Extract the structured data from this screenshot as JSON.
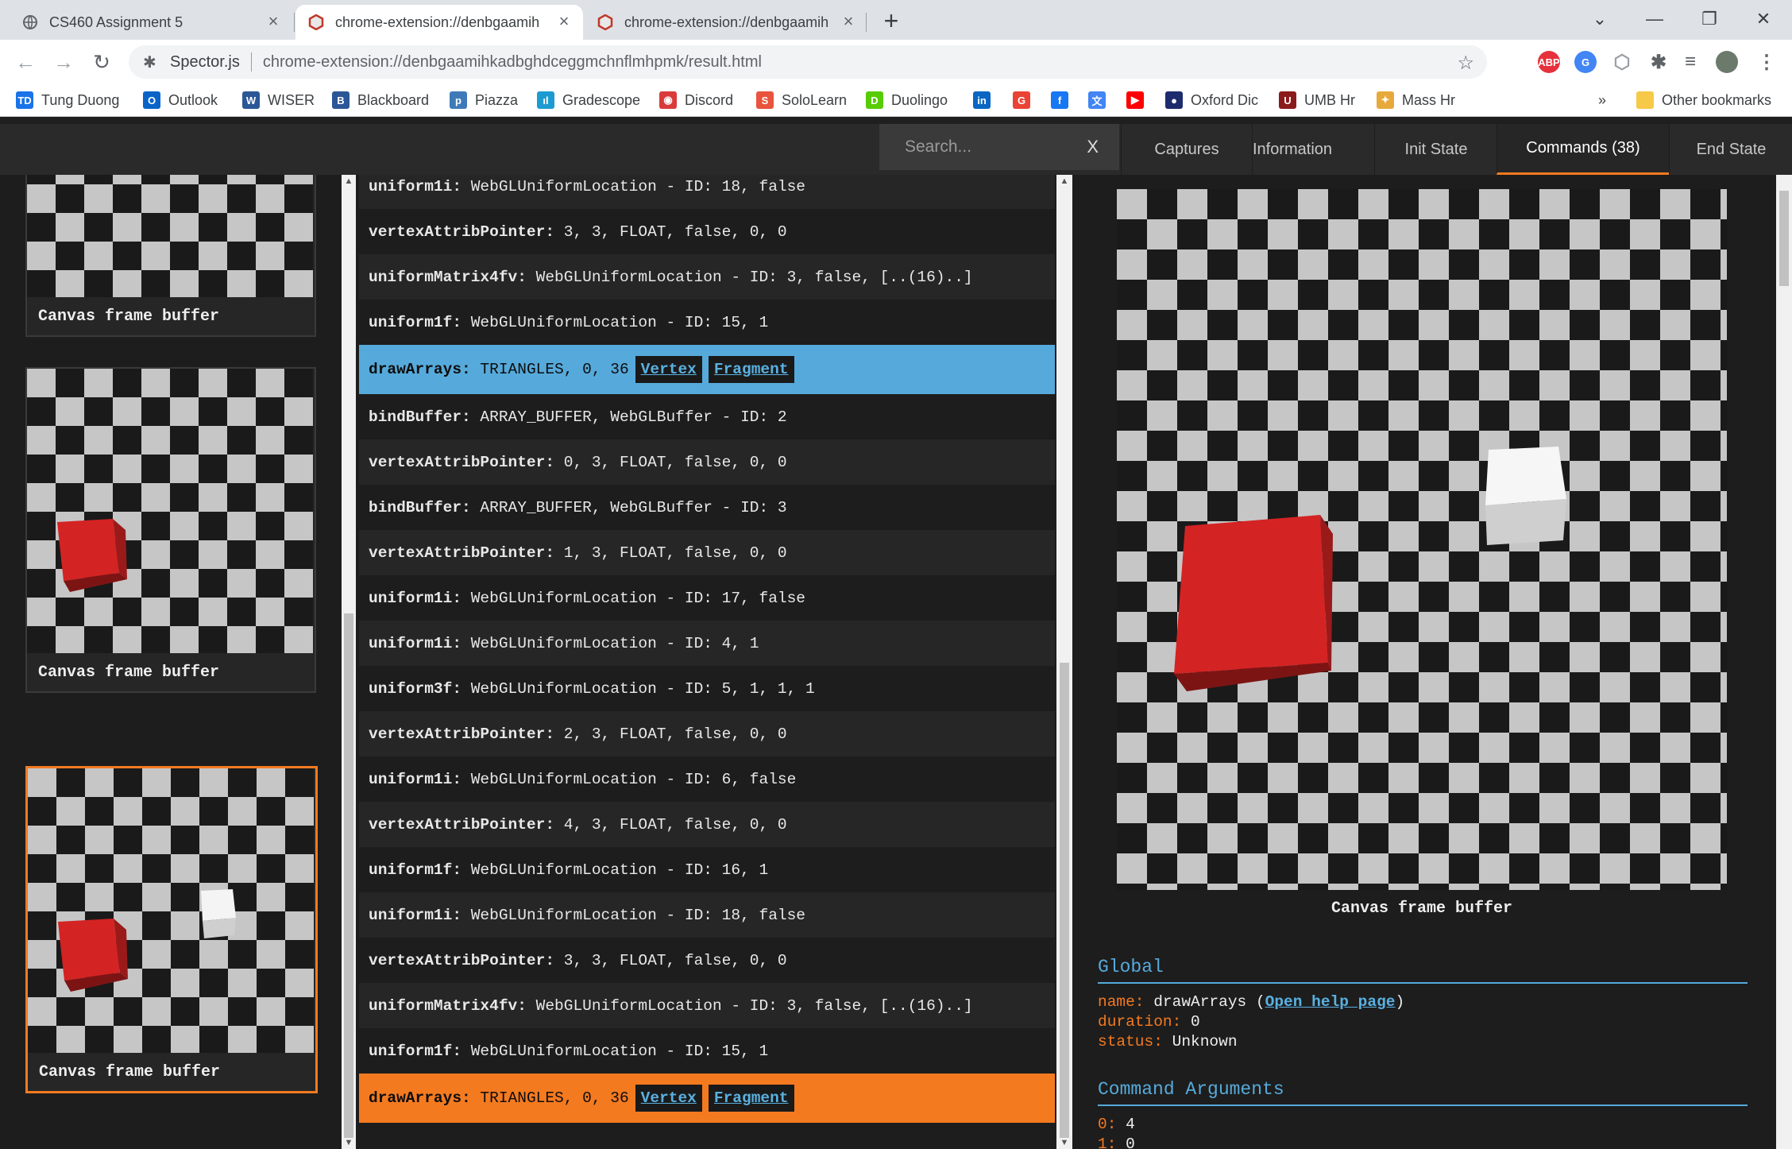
{
  "browser": {
    "tabs": [
      {
        "title": "CS460 Assignment 5",
        "active": false
      },
      {
        "title": "chrome-extension://denbgaamih",
        "active": true
      },
      {
        "title": "chrome-extension://denbgaamih",
        "active": false
      }
    ],
    "new_tab": "+",
    "window_controls": {
      "tabsearch": "⌄",
      "minimize": "—",
      "restore": "❐",
      "close": "✕"
    },
    "address": {
      "site": "Spector.js",
      "url": "chrome-extension://denbgaamihkadbghdceggmchnflmhpmk/result.html"
    },
    "extensions": [
      {
        "name": "adblock-plus-icon",
        "label": "ABP",
        "color": "#e6313c"
      },
      {
        "name": "google-translate-icon",
        "label": "G",
        "color": "#4285f4"
      },
      {
        "name": "spector-icon",
        "label": "⬡",
        "color": "#9aa0a6"
      },
      {
        "name": "extensions-puzzle-icon",
        "label": "✱",
        "color": "#5f6368"
      },
      {
        "name": "reading-list-icon",
        "label": "≡",
        "color": "#5f6368"
      },
      {
        "name": "profile-avatar",
        "label": "",
        "color": "#6b7a6b"
      },
      {
        "name": "menu-kebab-icon",
        "label": "⋮",
        "color": "#5f6368"
      }
    ]
  },
  "bookmarks": {
    "items": [
      {
        "label": "Tung Duong",
        "icon": "TD",
        "color": "#1a73e8"
      },
      {
        "label": "Outlook",
        "icon": "O",
        "color": "#0a64c8"
      },
      {
        "label": "WISER",
        "icon": "W",
        "color": "#2b5797"
      },
      {
        "label": "Blackboard",
        "icon": "B",
        "color": "#2b5797"
      },
      {
        "label": "Piazza",
        "icon": "p",
        "color": "#3e7ab8"
      },
      {
        "label": "Gradescope",
        "icon": "ıl",
        "color": "#1d9bd1"
      },
      {
        "label": "Discord",
        "icon": "◉",
        "color": "#d93a3a"
      },
      {
        "label": "SoloLearn",
        "icon": "S",
        "color": "#e8543c"
      },
      {
        "label": "Duolingo",
        "icon": "D",
        "color": "#58cc02"
      },
      {
        "label": "",
        "icon": "in",
        "color": "#0a66c2"
      },
      {
        "label": "",
        "icon": "G",
        "color": "#ea4335"
      },
      {
        "label": "",
        "icon": "f",
        "color": "#1877f2"
      },
      {
        "label": "",
        "icon": "文",
        "color": "#4285f4"
      },
      {
        "label": "",
        "icon": "▶",
        "color": "#ff0000"
      },
      {
        "label": "Oxford Dic",
        "icon": "●",
        "color": "#1c2c6c"
      },
      {
        "label": "UMB Hr",
        "icon": "U",
        "color": "#8b1a1a"
      },
      {
        "label": "Mass Hr",
        "icon": "✦",
        "color": "#e8a93c"
      }
    ],
    "more": "»",
    "other": "Other bookmarks"
  },
  "spector": {
    "search_placeholder": "Search...",
    "search_clear": "X",
    "tabs": [
      "Captures",
      "Information",
      "Init State",
      "Commands (38)",
      "End State"
    ],
    "active_tab": "Commands (38)",
    "captures": [
      {
        "label": "Canvas frame buffer",
        "selected": false
      },
      {
        "label": "Canvas frame buffer",
        "selected": false
      },
      {
        "label": "Canvas frame buffer",
        "selected": true
      }
    ],
    "commands": [
      {
        "name": "uniform1i:",
        "args": " WebGLUniformLocation - ID: 18, false"
      },
      {
        "name": "vertexAttribPointer:",
        "args": " 3, 3, FLOAT, false, 0, 0"
      },
      {
        "name": "uniformMatrix4fv:",
        "args": " WebGLUniformLocation - ID: 3, false, [..(16)..]"
      },
      {
        "name": "uniform1f:",
        "args": " WebGLUniformLocation - ID: 15, 1"
      },
      {
        "name": "drawArrays:",
        "args": " TRIANGLES, 0, 36",
        "links": [
          "Vertex",
          "Fragment"
        ],
        "state": "blue"
      },
      {
        "name": "bindBuffer:",
        "args": " ARRAY_BUFFER, WebGLBuffer - ID: 2"
      },
      {
        "name": "vertexAttribPointer:",
        "args": " 0, 3, FLOAT, false, 0, 0"
      },
      {
        "name": "bindBuffer:",
        "args": " ARRAY_BUFFER, WebGLBuffer - ID: 3"
      },
      {
        "name": "vertexAttribPointer:",
        "args": " 1, 3, FLOAT, false, 0, 0"
      },
      {
        "name": "uniform1i:",
        "args": " WebGLUniformLocation - ID: 17, false"
      },
      {
        "name": "uniform1i:",
        "args": " WebGLUniformLocation - ID: 4, 1"
      },
      {
        "name": "uniform3f:",
        "args": " WebGLUniformLocation - ID: 5, 1, 1, 1"
      },
      {
        "name": "vertexAttribPointer:",
        "args": " 2, 3, FLOAT, false, 0, 0"
      },
      {
        "name": "uniform1i:",
        "args": " WebGLUniformLocation - ID: 6, false"
      },
      {
        "name": "vertexAttribPointer:",
        "args": " 4, 3, FLOAT, false, 0, 0"
      },
      {
        "name": "uniform1f:",
        "args": " WebGLUniformLocation - ID: 16, 1"
      },
      {
        "name": "uniform1i:",
        "args": " WebGLUniformLocation - ID: 18, false"
      },
      {
        "name": "vertexAttribPointer:",
        "args": " 3, 3, FLOAT, false, 0, 0"
      },
      {
        "name": "uniformMatrix4fv:",
        "args": " WebGLUniformLocation - ID: 3, false, [..(16)..]"
      },
      {
        "name": "uniform1f:",
        "args": " WebGLUniformLocation - ID: 15, 1"
      },
      {
        "name": "drawArrays:",
        "args": " TRIANGLES, 0, 36",
        "links": [
          "Vertex",
          "Fragment"
        ],
        "state": "orange"
      }
    ],
    "preview_caption": "Canvas frame buffer",
    "global": {
      "title": "Global",
      "name_key": "name:",
      "name_val": "drawArrays",
      "help_link": "Open help page",
      "duration_key": "duration:",
      "duration_val": "0",
      "status_key": "status:",
      "status_val": "Unknown"
    },
    "arguments": {
      "title": "Command Arguments",
      "items": [
        {
          "key": "0:",
          "val": "4"
        },
        {
          "key": "1:",
          "val": "0"
        }
      ]
    },
    "colors": {
      "accent_orange": "#f47a20",
      "accent_blue": "#56aadb",
      "cube_red": "#d42323",
      "cube_white": "#f4f4f4"
    }
  }
}
